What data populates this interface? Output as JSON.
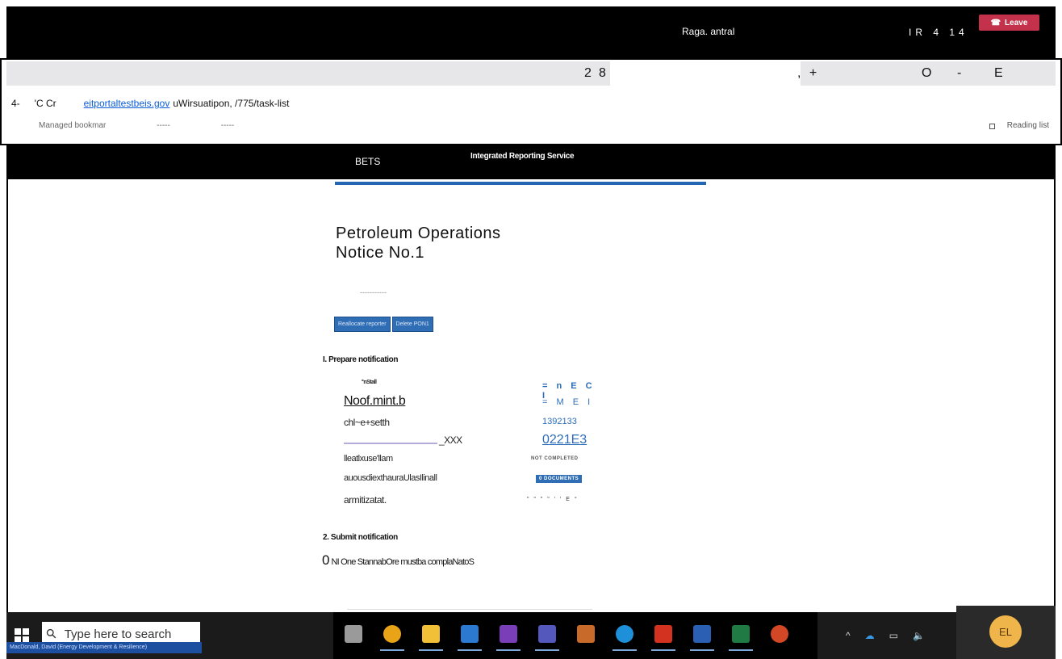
{
  "meeting": {
    "name": "Raga. antral",
    "timer": "IR 4 14",
    "leave_label": "Leave",
    "leave_color": "#c4314b"
  },
  "browser": {
    "tab_glyphs": {
      "t1": "2",
      "t2": "8",
      "t3": ", +",
      "t4": "O",
      "t5": "-",
      "t6": "E"
    },
    "nav_back": "4-",
    "nav_reload": "'C Cr",
    "url_link": "eitportaltestbeis.gov",
    "url_rest": "uWirsuatipon, /775/task-list",
    "bookmarks": [
      "Managed bookmar",
      "-----",
      "-----"
    ],
    "reading_list": "Reading list"
  },
  "site": {
    "brand": "BETS",
    "service": "Integrated Reporting Service",
    "accent": "#2367b4"
  },
  "page": {
    "title_line1": "Petroleum Operations",
    "title_line2": "Notice No.1",
    "dashes": "-----------",
    "actions": [
      "Reallocate reporter",
      "Delete PON1"
    ],
    "section1": "I. Prepare notification",
    "rows": [
      {
        "label": "''nStall",
        "value": "= n E C I"
      },
      {
        "label": "Noof.mint.b",
        "value": "= M E I"
      },
      {
        "label": "chl~e+setth",
        "value": "1392133"
      },
      {
        "label": "_XXX",
        "value": "0221E3"
      },
      {
        "label": "lleatlxuse'llam",
        "value": "NOT COMPLETED"
      },
      {
        "label": "auousdiexthauraUlasIlinall",
        "value": "0 DOCUMENTS"
      },
      {
        "label": "armitizatat.",
        "value": "\" \" \" \" ' ' E °"
      }
    ],
    "section2": "2. Submit notification",
    "submit_zero": "0",
    "submit_note": "NI One StannabOre mustba complaNatoS"
  },
  "taskbar": {
    "search_placeholder": "Type here to search",
    "caption": "MacDonald, David (Energy Development & Resilience)",
    "avatar_initials": "EL",
    "apps": [
      {
        "icon": "task-view-icon",
        "color": "#9a9a9a"
      },
      {
        "icon": "chrome-icon",
        "color": "#e8a317"
      },
      {
        "icon": "file-explorer-icon",
        "color": "#f2c037"
      },
      {
        "icon": "outlook-icon",
        "color": "#2b79d0"
      },
      {
        "icon": "onenote-icon",
        "color": "#7a3fb8"
      },
      {
        "icon": "teams-icon",
        "color": "#5458bd"
      },
      {
        "icon": "teams-notification-icon",
        "color": "#c76a2a"
      },
      {
        "icon": "edge-icon",
        "color": "#1e8fd9"
      },
      {
        "icon": "acrobat-icon",
        "color": "#d2321f"
      },
      {
        "icon": "word-icon",
        "color": "#2b5fb3"
      },
      {
        "icon": "excel-icon",
        "color": "#1f7a44"
      },
      {
        "icon": "powerpoint-icon",
        "color": "#d24726"
      }
    ]
  }
}
